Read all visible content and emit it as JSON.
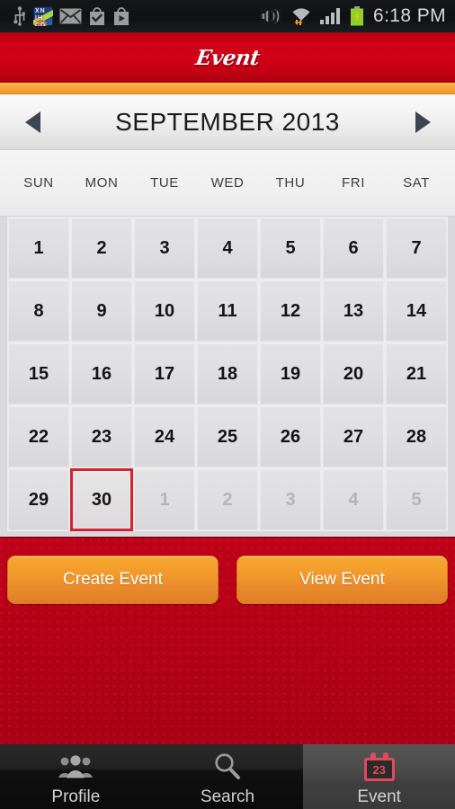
{
  "status_bar": {
    "time": "6:18 PM",
    "left_icons": [
      "usb-icon",
      "app-notification-icon",
      "mail-icon",
      "play-store-installed-icon",
      "play-store-icon"
    ],
    "app_icon_text": "XN IH CD",
    "right_icons": [
      "sound-muted-icon",
      "wifi-icon",
      "cellular-signal-icon",
      "battery-charging-icon"
    ]
  },
  "header": {
    "title": "Event"
  },
  "month_nav": {
    "prev_label": "previous-month",
    "next_label": "next-month",
    "month_year": "SEPTEMBER 2013"
  },
  "weekdays": [
    "SUN",
    "MON",
    "TUE",
    "WED",
    "THU",
    "FRI",
    "SAT"
  ],
  "calendar": {
    "selected_day": 30,
    "days": [
      {
        "n": "1",
        "muted": false
      },
      {
        "n": "2",
        "muted": false
      },
      {
        "n": "3",
        "muted": false
      },
      {
        "n": "4",
        "muted": false
      },
      {
        "n": "5",
        "muted": false
      },
      {
        "n": "6",
        "muted": false
      },
      {
        "n": "7",
        "muted": false
      },
      {
        "n": "8",
        "muted": false
      },
      {
        "n": "9",
        "muted": false
      },
      {
        "n": "10",
        "muted": false
      },
      {
        "n": "11",
        "muted": false
      },
      {
        "n": "12",
        "muted": false
      },
      {
        "n": "13",
        "muted": false
      },
      {
        "n": "14",
        "muted": false
      },
      {
        "n": "15",
        "muted": false
      },
      {
        "n": "16",
        "muted": false
      },
      {
        "n": "17",
        "muted": false
      },
      {
        "n": "18",
        "muted": false
      },
      {
        "n": "19",
        "muted": false
      },
      {
        "n": "20",
        "muted": false
      },
      {
        "n": "21",
        "muted": false
      },
      {
        "n": "22",
        "muted": false
      },
      {
        "n": "23",
        "muted": false
      },
      {
        "n": "24",
        "muted": false
      },
      {
        "n": "25",
        "muted": false
      },
      {
        "n": "26",
        "muted": false
      },
      {
        "n": "27",
        "muted": false
      },
      {
        "n": "28",
        "muted": false
      },
      {
        "n": "29",
        "muted": false
      },
      {
        "n": "30",
        "muted": false,
        "today": true
      },
      {
        "n": "1",
        "muted": true
      },
      {
        "n": "2",
        "muted": true
      },
      {
        "n": "3",
        "muted": true
      },
      {
        "n": "4",
        "muted": true
      },
      {
        "n": "5",
        "muted": true
      }
    ]
  },
  "actions": {
    "create_event": "Create Event",
    "view_event": "View Event"
  },
  "tabs": [
    {
      "label": "Profile",
      "icon": "people-icon",
      "active": false
    },
    {
      "label": "Search",
      "icon": "magnifier-icon",
      "active": false
    },
    {
      "label": "Event",
      "icon": "calendar-icon",
      "active": true
    }
  ],
  "tab_icon_day": "23",
  "colors": {
    "brand_red": "#c00014",
    "accent_orange": "#f2992c",
    "today_border": "#cf2233",
    "tab_active_bg": "#4c4c4c"
  }
}
